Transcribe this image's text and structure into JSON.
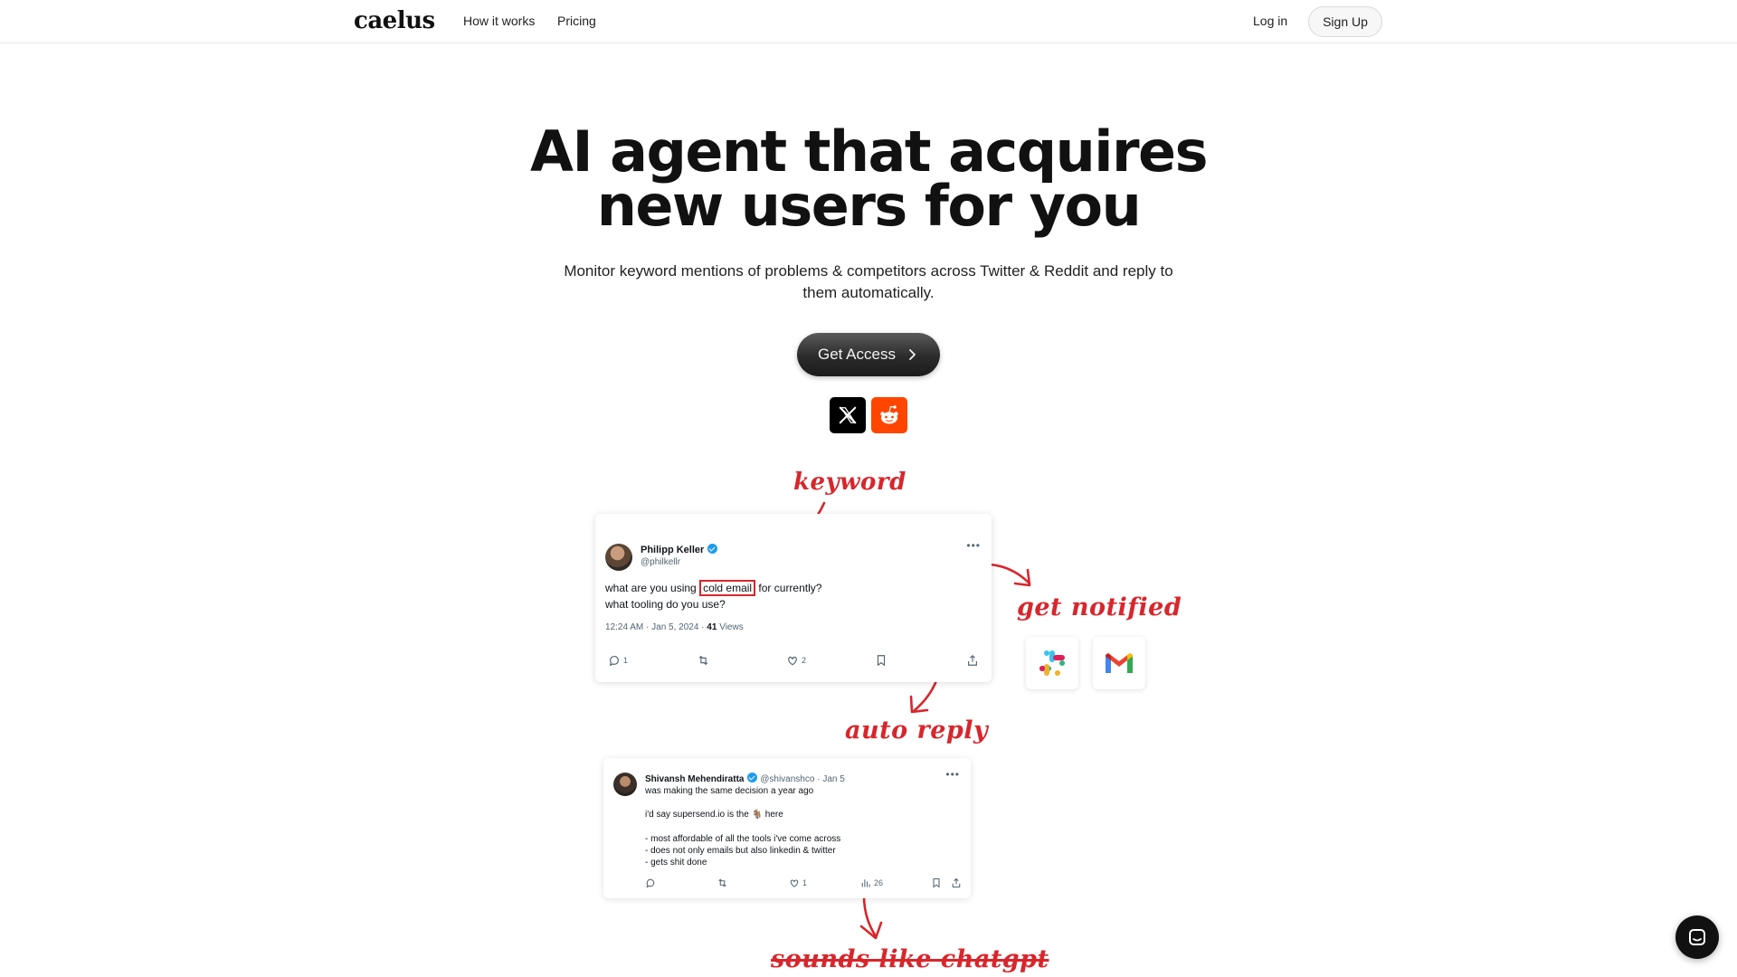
{
  "header": {
    "logo": "caelus",
    "nav": [
      "How it works",
      "Pricing"
    ],
    "login_label": "Log in",
    "signup_label": "Sign Up"
  },
  "hero": {
    "title_line1": "AI agent that acquires",
    "title_line2": "new users for you",
    "subtitle": "Monitor keyword mentions of problems & competitors across Twitter & Reddit and reply to them automatically.",
    "cta_label": "Get Access",
    "platform_icons": [
      "x-logo-icon",
      "reddit-logo-icon"
    ]
  },
  "annotations": {
    "keyword": "keyword",
    "get_notified": "get notified",
    "auto_reply": "auto reply",
    "sounds_like_chatgpt": "sounds like chatgpt"
  },
  "tweet1": {
    "name": "Philipp Keller",
    "handle": "@philkellr",
    "text_before": "what are you using ",
    "keyword": "cold email",
    "text_after": " for currently?",
    "text_line2": "what tooling do you use?",
    "meta_date": "12:24 AM · Jan 5, 2024 · ",
    "views_count": "41",
    "views_label": " Views",
    "replies": "1",
    "likes": "2"
  },
  "integrations": [
    "slack-icon",
    "gmail-icon"
  ],
  "tweet2": {
    "name": "Shivansh Mehendiratta",
    "handle_date": "@shivanshco · Jan 5",
    "line1": "was making the same decision a year ago",
    "line2": "i'd say supersend.io is the 🐐 here",
    "line3": "- most affordable of all the tools i've come across",
    "line4": "- does not only emails but also linkedin & twitter",
    "line5": "- gets shit done",
    "likes": "1",
    "views": "26"
  },
  "colors": {
    "annotation_red": "#d8262c",
    "reddit_orange": "#ff4500",
    "twitter_blue": "#1d9bf0"
  }
}
